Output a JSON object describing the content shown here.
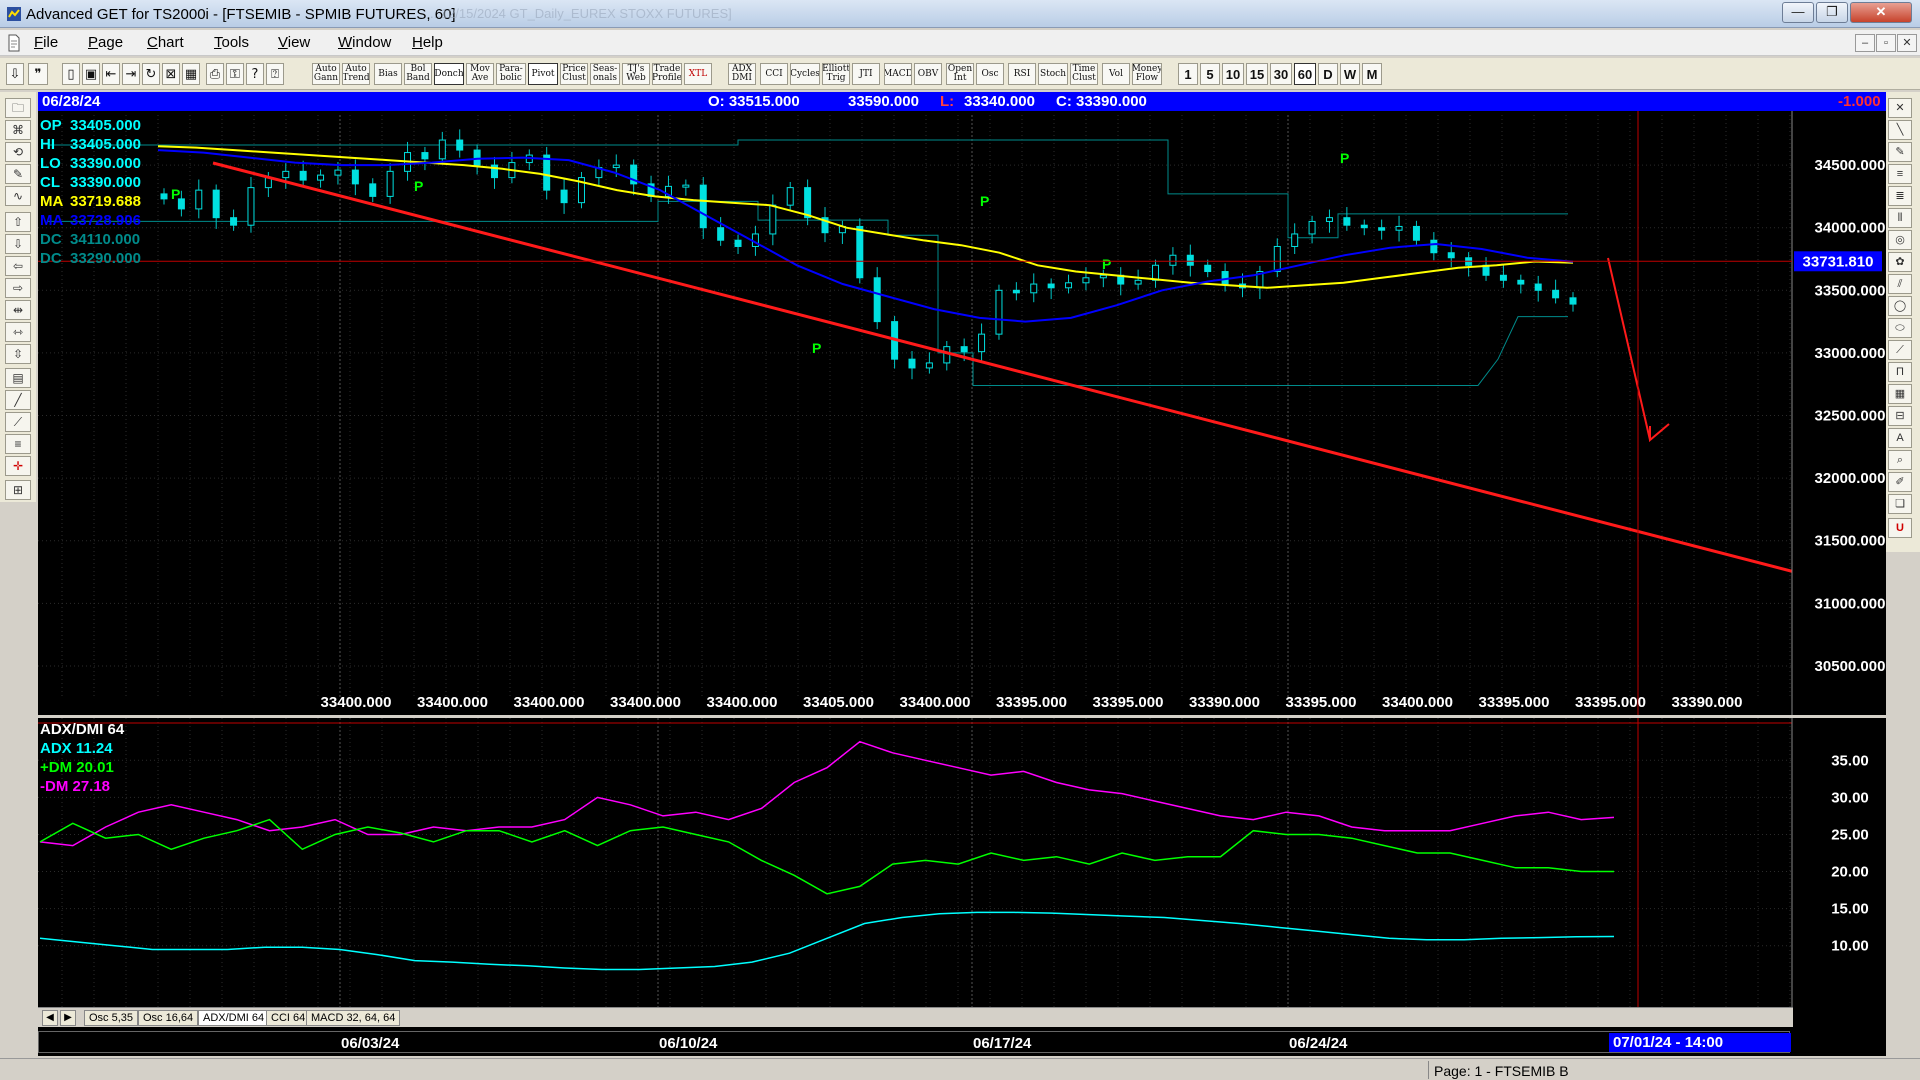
{
  "window": {
    "title": "Advanced GET for TS2000i - [FTSEMIB - SPMIB FUTURES, 60]",
    "ghost_title": "...12/15/2024 GT_Daily_EUREX STOXX FUTURES]",
    "min_glyph": "—",
    "max_glyph": "❐",
    "close_glyph": "✕"
  },
  "menu": {
    "items": [
      {
        "label": "File",
        "key": "F"
      },
      {
        "label": "Page",
        "key": "P"
      },
      {
        "label": "Chart",
        "key": "C"
      },
      {
        "label": "Tools",
        "key": "T"
      },
      {
        "label": "View",
        "key": "V"
      },
      {
        "label": "Window",
        "key": "W"
      },
      {
        "label": "Help",
        "key": "H"
      }
    ],
    "mdi_min": "–",
    "mdi_restore": "▫",
    "mdi_close": "✕"
  },
  "toolbar": {
    "studies": [
      "Auto Gann",
      "Auto Trend",
      "Bias",
      "Bol Band",
      "Donch",
      "Mov Ave",
      "Para-bolic",
      "Pivot",
      "Price Clust",
      "Seas-onals",
      "TJ's Web",
      "Trade Profile",
      "XTL",
      "ADX DMI",
      "CCI",
      "Cycles",
      "Elliott Trig",
      "JTI",
      "MACD",
      "OBV",
      "Open Int",
      "Osc",
      "RSI",
      "Stoch",
      "Time Clust",
      "Vol",
      "Money Flow"
    ],
    "timeframes": [
      "1",
      "5",
      "10",
      "15",
      "30",
      "60",
      "D",
      "W",
      "M"
    ],
    "active_timeframe": "60"
  },
  "infobar": {
    "date": "06/28/24",
    "open": "O: 33515.000",
    "high": "33590.000",
    "low_label": "L:",
    "low": "33340.000",
    "close": "C: 33390.000",
    "change": "-1.000"
  },
  "main_legend": [
    {
      "label": "OP",
      "value": "33405.000",
      "color": "#00ffff"
    },
    {
      "label": "HI",
      "value": "33405.000",
      "color": "#00ffff"
    },
    {
      "label": "LO",
      "value": "33390.000",
      "color": "#00ffff"
    },
    {
      "label": "CL",
      "value": "33390.000",
      "color": "#00ffff"
    },
    {
      "label": "MA",
      "value": "33719.688",
      "color": "#ffff00"
    },
    {
      "label": "MA",
      "value": "33728.906",
      "color": "#0000ff"
    },
    {
      "label": "DC",
      "value": "34110.000",
      "color": "#008b8b"
    },
    {
      "label": "DC",
      "value": "33290.000",
      "color": "#008b8b"
    }
  ],
  "price_axis": {
    "labels": [
      "34500.000",
      "34000.000",
      "33500.000",
      "33000.000",
      "32500.000",
      "32000.000",
      "31500.000",
      "31000.000",
      "30500.000"
    ],
    "values": [
      34500,
      34000,
      33500,
      33000,
      32500,
      32000,
      31500,
      31000,
      30500
    ],
    "current_price": "33731.810",
    "current_value": 33731.81
  },
  "bottom_prices": [
    "33400.000",
    "33400.000",
    "33400.000",
    "33400.000",
    "33400.000",
    "33405.000",
    "33400.000",
    "33395.000",
    "33395.000",
    "33390.000",
    "33395.000",
    "33400.000",
    "33395.000",
    "33395.000",
    "33390.000"
  ],
  "pivot_marker": "P",
  "sub_legend": {
    "title": "ADX/DMI 64",
    "adx": "ADX 11.24",
    "plus_dm": "+DM 20.01",
    "minus_dm": "-DM  27.18",
    "colors": {
      "adx": "#00ffff",
      "plus": "#00ff00",
      "minus": "#ff00ff",
      "title": "#ffffff"
    }
  },
  "sub_axis": {
    "labels": [
      "35.00",
      "30.00",
      "25.00",
      "20.00",
      "15.00",
      "10.00"
    ],
    "values": [
      35,
      30,
      25,
      20,
      15,
      10
    ]
  },
  "tabs": [
    "Osc 5,35",
    "Osc 16,64",
    "ADX/DMI 64",
    "CCI 64",
    "MACD 32, 64, 64"
  ],
  "active_tab": "ADX/DMI 64",
  "dates": [
    "06/03/24",
    "06/10/24",
    "06/17/24",
    "06/24/24"
  ],
  "cursor_date": "07/01/24 - 14:00",
  "status": "Page: 1 - FTSEMIB B",
  "chart_data": {
    "type": "line",
    "title": "FTSEMIB - SPMIB FUTURES, 60",
    "ylim": [
      30300,
      34900
    ],
    "series": [
      {
        "name": "CL",
        "color": "#ffffff",
        "values": [
          34230,
          34150,
          34300,
          34080,
          34020,
          34320,
          34400,
          34450,
          34380,
          34420,
          34460,
          34350,
          34250,
          34450,
          34600,
          34550,
          34700,
          34620,
          34500,
          34400,
          34520,
          34580,
          34300,
          34200,
          34400,
          34480,
          34500,
          34350,
          34250,
          34330,
          34340,
          34000,
          33900,
          33850,
          33950,
          34180,
          34320,
          34080,
          33960,
          34010,
          33600,
          33250,
          32950,
          32880,
          32920,
          33050,
          33010,
          33150,
          33500,
          33480,
          33550,
          33520,
          33560,
          33600,
          33620,
          33550,
          33580,
          33700,
          33780,
          33700,
          33650,
          33550,
          33520,
          33650,
          33850,
          33950,
          34050,
          34080,
          34020,
          34000,
          33980,
          34010,
          33900,
          33800,
          33760,
          33700,
          33620,
          33580,
          33550,
          33500,
          33440,
          33390
        ]
      },
      {
        "name": "MA",
        "color": "#ffff00",
        "values": [
          34650,
          34640,
          34620,
          34600,
          34580,
          34560,
          34540,
          34520,
          34500,
          34470,
          34430,
          34370,
          34300,
          34250,
          34220,
          34200,
          34180,
          34100,
          34000,
          33950,
          33900,
          33860,
          33800,
          33700,
          33650,
          33620,
          33590,
          33560,
          33540,
          33520,
          33540,
          33560,
          33600,
          33640,
          33680,
          33700,
          33730,
          33720
        ]
      },
      {
        "name": "MA",
        "color": "#0000ff",
        "values": [
          34620,
          34600,
          34560,
          34520,
          34500,
          34500,
          34520,
          34550,
          34560,
          34540,
          34440,
          34300,
          34100,
          33900,
          33700,
          33550,
          33450,
          33350,
          33280,
          33250,
          33280,
          33380,
          33500,
          33570,
          33620,
          33700,
          33780,
          33840,
          33870,
          33830,
          33760,
          33728
        ]
      }
    ]
  }
}
